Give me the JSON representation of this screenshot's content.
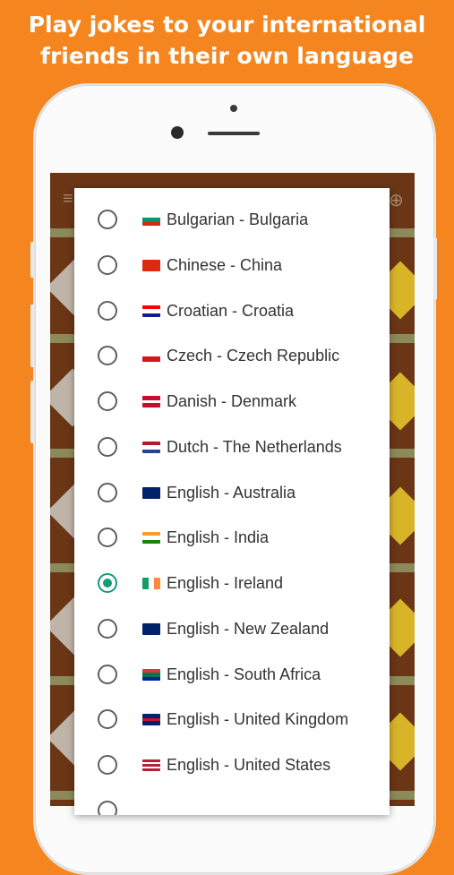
{
  "headline": {
    "line1": "Play jokes to your international",
    "line2": "friends in their own language"
  },
  "colors": {
    "background": "#f5861f",
    "radio_selected": "#169a78",
    "radio_unselected": "#5f5f5f"
  },
  "language_options": [
    {
      "label": "Bulgarian - Bulgaria",
      "selected": false,
      "flag_icon": "bulgaria-flag-icon"
    },
    {
      "label": "Chinese - China",
      "selected": false,
      "flag_icon": "china-flag-icon"
    },
    {
      "label": "Croatian - Croatia",
      "selected": false,
      "flag_icon": "croatia-flag-icon"
    },
    {
      "label": "Czech - Czech Republic",
      "selected": false,
      "flag_icon": "czech-republic-flag-icon"
    },
    {
      "label": "Danish - Denmark",
      "selected": false,
      "flag_icon": "denmark-flag-icon"
    },
    {
      "label": "Dutch - The Netherlands",
      "selected": false,
      "flag_icon": "netherlands-flag-icon"
    },
    {
      "label": "English - Australia",
      "selected": false,
      "flag_icon": "australia-flag-icon"
    },
    {
      "label": "English - India",
      "selected": false,
      "flag_icon": "india-flag-icon"
    },
    {
      "label": "English - Ireland",
      "selected": true,
      "flag_icon": "ireland-flag-icon"
    },
    {
      "label": "English - New Zealand",
      "selected": false,
      "flag_icon": "new-zealand-flag-icon"
    },
    {
      "label": "English - South Africa",
      "selected": false,
      "flag_icon": "south-africa-flag-icon"
    },
    {
      "label": "English - United Kingdom",
      "selected": false,
      "flag_icon": "united-kingdom-flag-icon"
    },
    {
      "label": "English - United States",
      "selected": false,
      "flag_icon": "united-states-flag-icon"
    }
  ]
}
